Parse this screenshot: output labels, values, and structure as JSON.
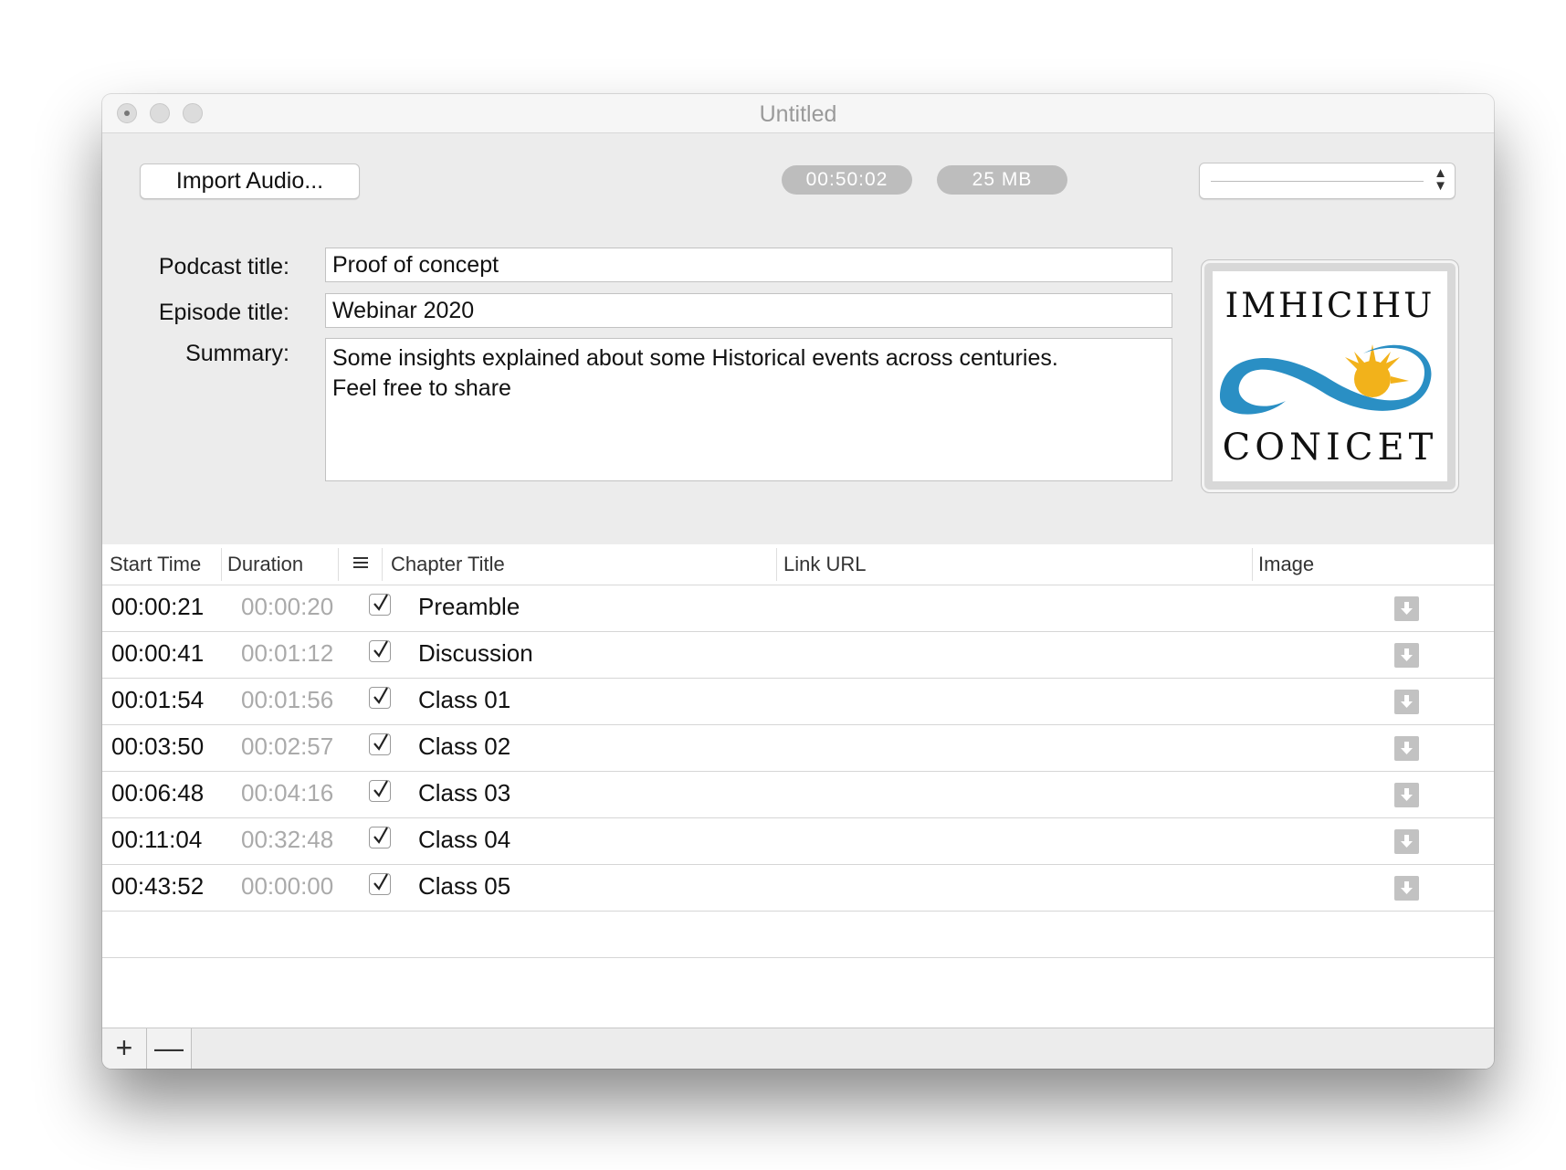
{
  "window": {
    "title": "Untitled"
  },
  "toolbar": {
    "import_label": "Import Audio...",
    "duration": "00:50:02",
    "file_size": "25 MB",
    "popup_value": ""
  },
  "form": {
    "podcast_title_label": "Podcast title:",
    "podcast_title_value": "Proof of concept",
    "episode_title_label": "Episode title:",
    "episode_title_value": "Webinar 2020",
    "summary_label": "Summary:",
    "summary_line1": "Some insights explained about some Historical events across centuries.",
    "summary_line2": "Feel free to share"
  },
  "artwork": {
    "top_text": "IMHICIHU",
    "bottom_text": "CONICET",
    "colors": {
      "wave": "#2a8fc4",
      "sun": "#f2b21b"
    }
  },
  "table": {
    "headers": {
      "start": "Start Time",
      "duration": "Duration",
      "toggle_icon": "list-icon",
      "chapter": "Chapter Title",
      "url": "Link URL",
      "image": "Image"
    },
    "rows": [
      {
        "start": "00:00:21",
        "duration": "00:00:20",
        "checked": true,
        "title": "Preamble"
      },
      {
        "start": "00:00:41",
        "duration": "00:01:12",
        "checked": true,
        "title": "Discussion"
      },
      {
        "start": "00:01:54",
        "duration": "00:01:56",
        "checked": true,
        "title": "Class 01"
      },
      {
        "start": "00:03:50",
        "duration": "00:02:57",
        "checked": true,
        "title": "Class 02"
      },
      {
        "start": "00:06:48",
        "duration": "00:04:16",
        "checked": true,
        "title": "Class 03"
      },
      {
        "start": "00:11:04",
        "duration": "00:32:48",
        "checked": true,
        "title": "Class 04"
      },
      {
        "start": "00:43:52",
        "duration": "00:00:00",
        "checked": true,
        "title": "Class 05"
      }
    ]
  },
  "footer": {
    "add_label": "+",
    "remove_label": "—"
  }
}
